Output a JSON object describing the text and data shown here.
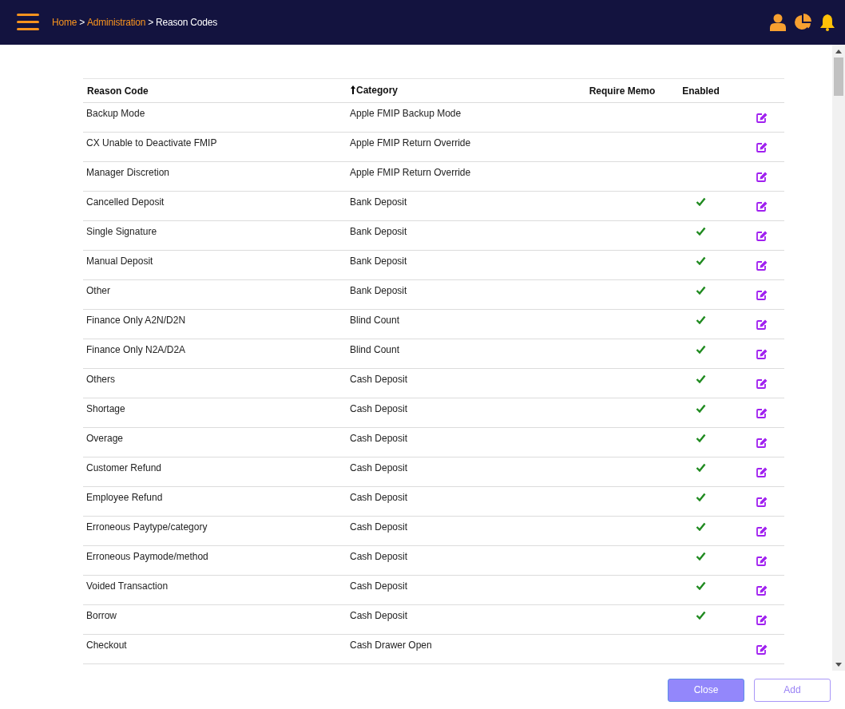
{
  "header": {
    "breadcrumb": [
      {
        "label": "Home",
        "link": true
      },
      {
        "label": "Administration",
        "link": true
      },
      {
        "label": "Reason Codes",
        "link": false
      }
    ],
    "separator": ">"
  },
  "table": {
    "columns": [
      {
        "label": "Reason Code",
        "sorted": false
      },
      {
        "label": "Category",
        "sorted": true
      },
      {
        "label": "Require Memo",
        "sorted": false
      },
      {
        "label": "Enabled",
        "sorted": false
      }
    ],
    "rows": [
      {
        "reason_code": "Backup Mode",
        "category": "Apple FMIP Backup Mode",
        "require_memo": false,
        "enabled": false
      },
      {
        "reason_code": "CX Unable to Deactivate FMIP",
        "category": "Apple FMIP Return Override",
        "require_memo": false,
        "enabled": false
      },
      {
        "reason_code": "Manager Discretion",
        "category": "Apple FMIP Return Override",
        "require_memo": false,
        "enabled": false
      },
      {
        "reason_code": "Cancelled Deposit",
        "category": "Bank Deposit",
        "require_memo": false,
        "enabled": true
      },
      {
        "reason_code": "Single Signature",
        "category": "Bank Deposit",
        "require_memo": false,
        "enabled": true
      },
      {
        "reason_code": "Manual Deposit",
        "category": "Bank Deposit",
        "require_memo": false,
        "enabled": true
      },
      {
        "reason_code": "Other",
        "category": "Bank Deposit",
        "require_memo": false,
        "enabled": true
      },
      {
        "reason_code": "Finance Only A2N/D2N",
        "category": "Blind Count",
        "require_memo": false,
        "enabled": true
      },
      {
        "reason_code": "Finance Only N2A/D2A",
        "category": "Blind Count",
        "require_memo": false,
        "enabled": true
      },
      {
        "reason_code": "Others",
        "category": "Cash Deposit",
        "require_memo": false,
        "enabled": true
      },
      {
        "reason_code": "Shortage",
        "category": "Cash Deposit",
        "require_memo": false,
        "enabled": true
      },
      {
        "reason_code": "Overage",
        "category": "Cash Deposit",
        "require_memo": false,
        "enabled": true
      },
      {
        "reason_code": "Customer Refund",
        "category": "Cash Deposit",
        "require_memo": false,
        "enabled": true
      },
      {
        "reason_code": "Employee Refund",
        "category": "Cash Deposit",
        "require_memo": false,
        "enabled": true
      },
      {
        "reason_code": "Erroneous Paytype/category",
        "category": "Cash Deposit",
        "require_memo": false,
        "enabled": true
      },
      {
        "reason_code": "Erroneous Paymode/method",
        "category": "Cash Deposit",
        "require_memo": false,
        "enabled": true
      },
      {
        "reason_code": "Voided Transaction",
        "category": "Cash Deposit",
        "require_memo": false,
        "enabled": true
      },
      {
        "reason_code": "Borrow",
        "category": "Cash Deposit",
        "require_memo": false,
        "enabled": true
      },
      {
        "reason_code": "Checkout",
        "category": "Cash Drawer Open",
        "require_memo": false,
        "enabled": false
      }
    ]
  },
  "buttons": [
    {
      "label": "Close",
      "kind": "primary"
    },
    {
      "label": "Add",
      "kind": "outline"
    }
  ]
}
